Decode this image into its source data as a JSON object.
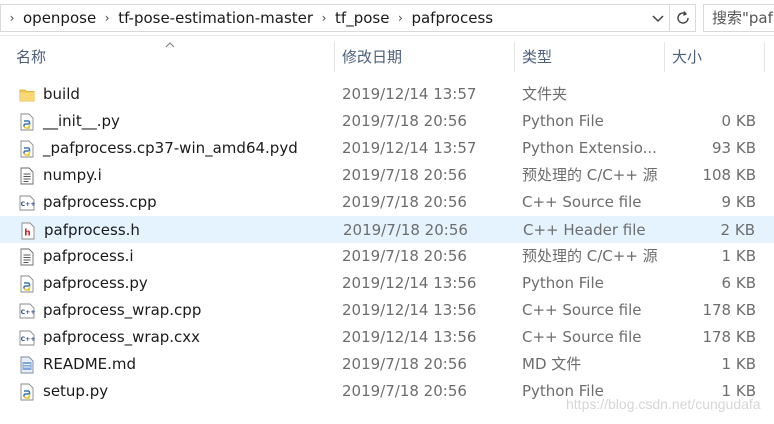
{
  "address": {
    "breadcrumbs": [
      "openpose",
      "tf-pose-estimation-master",
      "tf_pose",
      "pafprocess"
    ],
    "search_placeholder": "搜索\"pafprocess\""
  },
  "columns": {
    "name": "名称",
    "date": "修改日期",
    "type": "类型",
    "size": "大小"
  },
  "files": [
    {
      "name": "build",
      "date": "2019/12/14 13:57",
      "type": "文件夹",
      "size": "",
      "icon": "folder-icon"
    },
    {
      "name": "__init__.py",
      "date": "2019/7/18 20:56",
      "type": "Python File",
      "size": "0 KB",
      "icon": "python-file-icon"
    },
    {
      "name": "_pafprocess.cp37-win_amd64.pyd",
      "date": "2019/12/14 13:57",
      "type": "Python Extensio...",
      "size": "93 KB",
      "icon": "python-file-icon"
    },
    {
      "name": "numpy.i",
      "date": "2019/7/18 20:56",
      "type": "预处理的 C/C++ 源",
      "size": "108 KB",
      "icon": "text-file-icon"
    },
    {
      "name": "pafprocess.cpp",
      "date": "2019/7/18 20:56",
      "type": "C++ Source file",
      "size": "9 KB",
      "icon": "cpp-file-icon"
    },
    {
      "name": "pafprocess.h",
      "date": "2019/7/18 20:56",
      "type": "C++ Header file",
      "size": "2 KB",
      "icon": "header-file-icon"
    },
    {
      "name": "pafprocess.i",
      "date": "2019/7/18 20:56",
      "type": "预处理的 C/C++ 源",
      "size": "1 KB",
      "icon": "text-file-icon"
    },
    {
      "name": "pafprocess.py",
      "date": "2019/12/14 13:56",
      "type": "Python File",
      "size": "6 KB",
      "icon": "python-file-icon"
    },
    {
      "name": "pafprocess_wrap.cpp",
      "date": "2019/12/14 13:56",
      "type": "C++ Source file",
      "size": "178 KB",
      "icon": "cpp-file-icon"
    },
    {
      "name": "pafprocess_wrap.cxx",
      "date": "2019/12/14 13:56",
      "type": "C++ Source file",
      "size": "178 KB",
      "icon": "cpp-file-icon"
    },
    {
      "name": "README.md",
      "date": "2019/7/18 20:56",
      "type": "MD 文件",
      "size": "1 KB",
      "icon": "markdown-file-icon"
    },
    {
      "name": "setup.py",
      "date": "2019/7/18 20:56",
      "type": "Python File",
      "size": "1 KB",
      "icon": "python-file-icon"
    }
  ],
  "selected_index": 5,
  "watermark": "https://blog.csdn.net/cungudafa"
}
